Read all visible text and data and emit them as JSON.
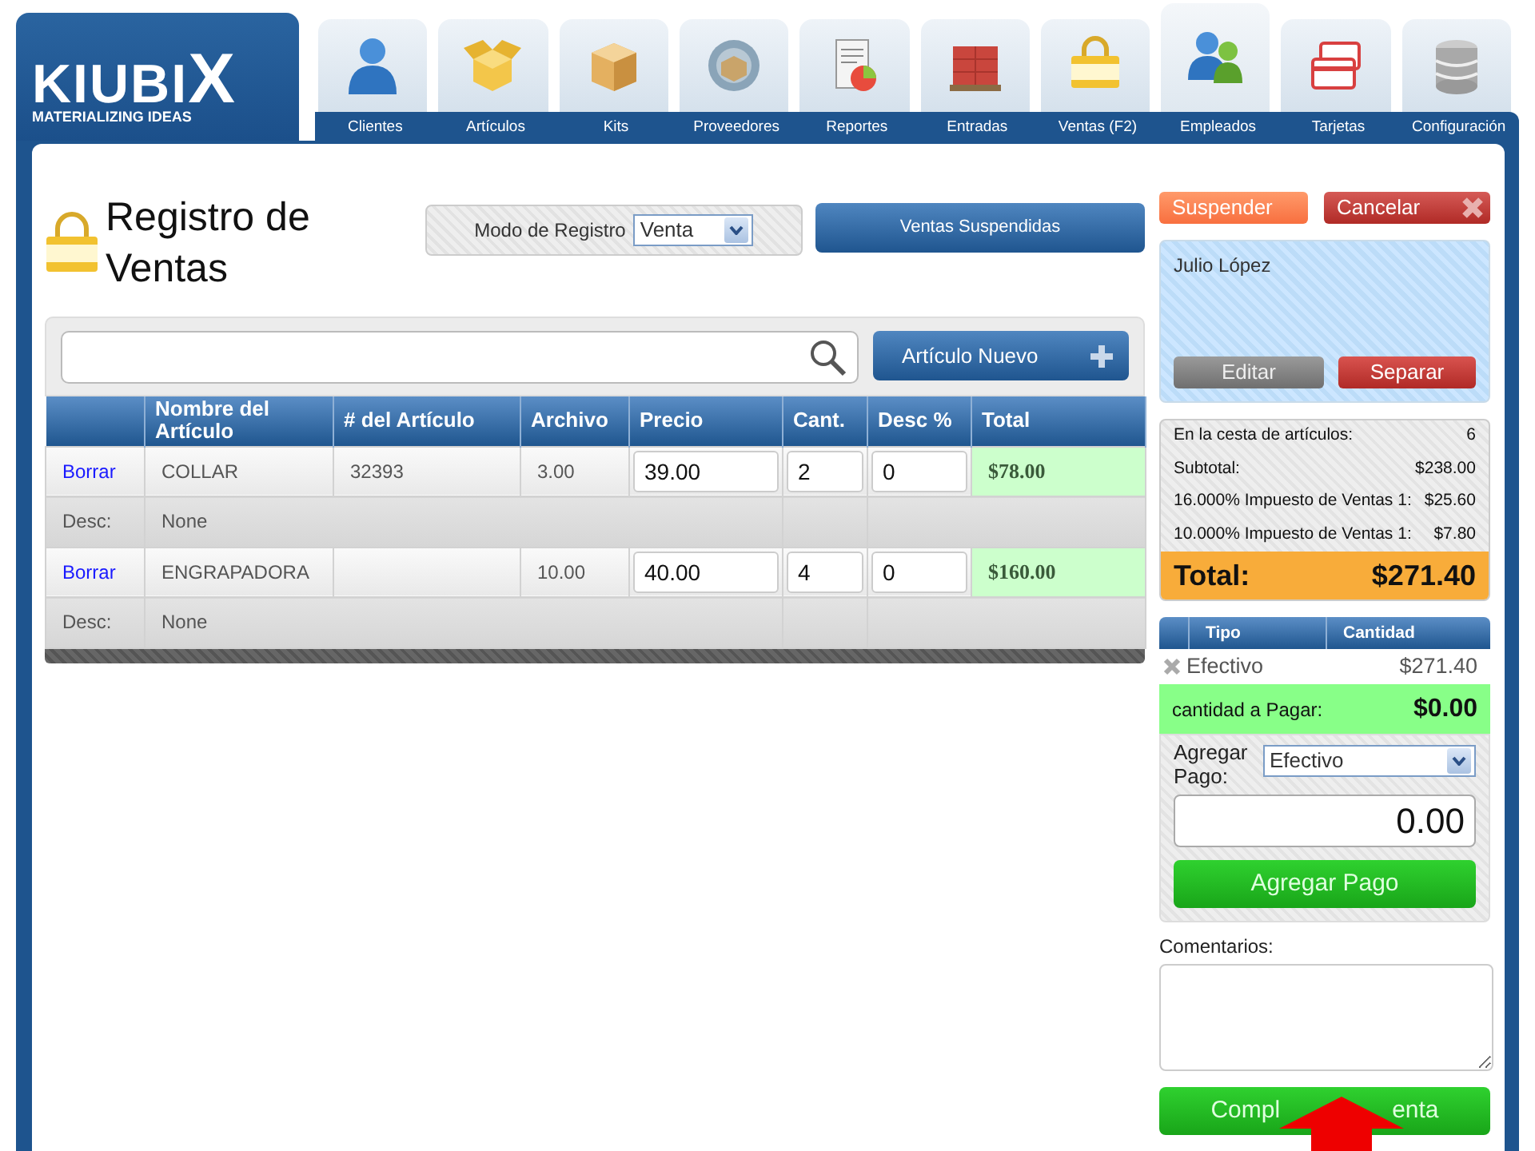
{
  "logo": {
    "main": "KIUBI",
    "mark": "X",
    "tagline": "MATERIALIZING IDEAS"
  },
  "tabs": [
    {
      "label": "Clientes",
      "selected": false
    },
    {
      "label": "Artículos",
      "selected": false
    },
    {
      "label": "Kits",
      "selected": false
    },
    {
      "label": "Proveedores",
      "selected": false
    },
    {
      "label": "Reportes",
      "selected": false
    },
    {
      "label": "Entradas",
      "selected": false
    },
    {
      "label": "Ventas (F2)",
      "selected": false
    },
    {
      "label": "Empleados",
      "selected": true
    },
    {
      "label": "Tarjetas",
      "selected": false
    },
    {
      "label": "Configuración",
      "selected": false
    }
  ],
  "page_title": "Registro de Ventas",
  "mode": {
    "label": "Modo de Registro",
    "value": "Venta"
  },
  "suspended_sales_button": "Ventas Suspendidas",
  "new_item_button": "Artículo Nuevo",
  "cart": {
    "columns": [
      "Nombre del Artículo",
      "# del Artículo",
      "Archivo",
      "Precio",
      "Cant.",
      "Desc %",
      "Total"
    ],
    "rows": [
      {
        "action": "Borrar",
        "name": "COLLAR",
        "item_number": "32393",
        "stock": "3.00",
        "price": "39.00",
        "quantity": "2",
        "discount": "0",
        "total": "$78.00",
        "desc_label": "Desc:",
        "desc": "None"
      },
      {
        "action": "Borrar",
        "name": "ENGRAPADORA",
        "stock": "10.00",
        "price": "40.00",
        "quantity": "4",
        "discount": "0",
        "total": "$160.00",
        "desc_label": "Desc:",
        "desc": "None"
      }
    ]
  },
  "suspend_button": "Suspender",
  "cancel_button": "Cancelar",
  "customer": {
    "name": "Julio López",
    "edit_button": "Editar",
    "detach_button": "Separar"
  },
  "summary": [
    {
      "label": "En la cesta de artículos:",
      "value": "6"
    },
    {
      "label": "Subtotal:",
      "value": "$238.00"
    },
    {
      "label": "16.000% Impuesto de Ventas 1:",
      "value": "$25.60"
    },
    {
      "label": "10.000% Impuesto de Ventas 1:",
      "value": "$7.80"
    }
  ],
  "total": {
    "label": "Total:",
    "value": "$271.40"
  },
  "payments": {
    "columns": [
      "Tipo",
      "Cantidad"
    ],
    "rows": [
      {
        "type": "Efectivo",
        "amount": "$271.40"
      }
    ]
  },
  "amount_due": {
    "label": "cantidad a Pagar:",
    "value": "$0.00"
  },
  "add_payment": {
    "label": "Agregar Pago:",
    "type": "Efectivo",
    "amount": "0.00",
    "button": "Agregar Pago"
  },
  "comments": {
    "label": "Comentarios:"
  },
  "complete_button": {
    "visible_parts": [
      "Compl",
      "enta"
    ]
  }
}
